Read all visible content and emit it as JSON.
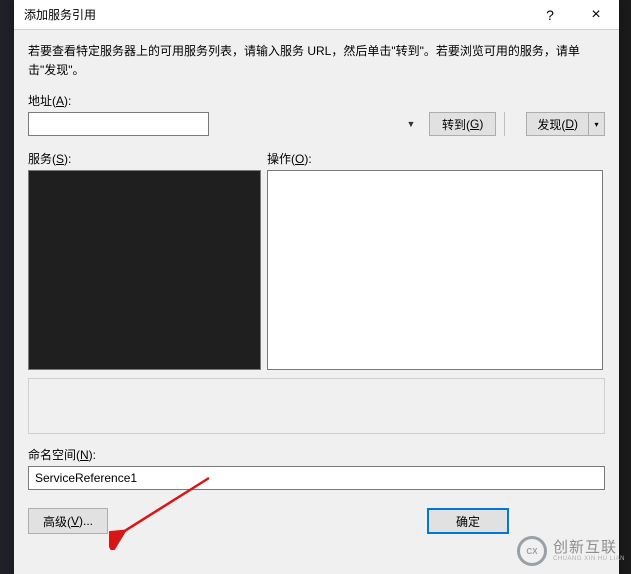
{
  "title": "添加服务引用",
  "titlebar": {
    "help_label": "?",
    "close_label": "×"
  },
  "instruction": "若要查看特定服务器上的可用服务列表，请输入服务 URL，然后单击\"转到\"。若要浏览可用的服务，请单击\"发现\"。",
  "address": {
    "label_prefix": "地址(",
    "label_key": "A",
    "label_suffix": "):",
    "value": "",
    "go_prefix": "转到(",
    "go_key": "G",
    "go_suffix": ")",
    "discover_prefix": "发现(",
    "discover_key": "D",
    "discover_suffix": ")"
  },
  "services": {
    "label_prefix": "服务(",
    "label_key": "S",
    "label_suffix": "):"
  },
  "operations": {
    "label_prefix": "操作(",
    "label_key": "O",
    "label_suffix": "):"
  },
  "namespace": {
    "label_prefix": "命名空间(",
    "label_key": "N",
    "label_suffix": "):",
    "value": "ServiceReference1"
  },
  "buttons": {
    "advanced_prefix": "高级(",
    "advanced_key": "V",
    "advanced_suffix": ")...",
    "ok": "确定"
  },
  "watermark": {
    "main": "创新互联",
    "sub": "CHUANG XIN HU LIAN"
  }
}
